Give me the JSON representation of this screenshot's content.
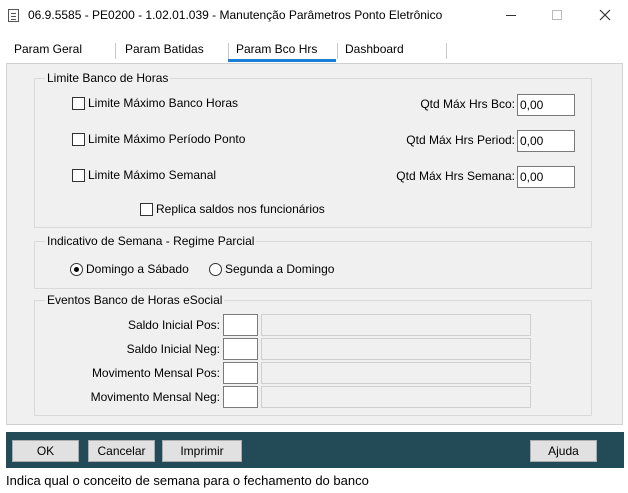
{
  "window": {
    "title": "06.9.5585 - PE0200 - 1.02.01.039 - Manutenção Parâmetros Ponto Eletrônico",
    "icon": "app-window-icon"
  },
  "tabs": [
    {
      "label": "Param Geral",
      "active": false
    },
    {
      "label": "Param Batidas",
      "active": false
    },
    {
      "label": "Param Bco Hrs",
      "active": true
    },
    {
      "label": "Dashboard",
      "active": false
    }
  ],
  "limite": {
    "title": "Limite Banco de Horas",
    "chk_max_banco": "Limite Máximo Banco Horas",
    "chk_max_periodo": "Limite Máximo Período Ponto",
    "chk_max_semanal": "Limite Máximo Semanal",
    "chk_replica": "Replica saldos nos funcionários",
    "lbl_qtd_bco": "Qtd Máx Hrs Bco:",
    "lbl_qtd_period": "Qtd Máx Hrs Period:",
    "lbl_qtd_semana": "Qtd Máx Hrs Semana:",
    "val_qtd_bco": "0,00",
    "val_qtd_period": "0,00",
    "val_qtd_semana": "0,00"
  },
  "semana": {
    "title": "Indicativo de Semana - Regime Parcial",
    "opt_domingo": "Domingo a Sábado",
    "opt_segunda": "Segunda a Domingo",
    "selected": "Domingo a Sábado"
  },
  "eventos": {
    "title": "Eventos Banco de Horas eSocial",
    "rows": [
      {
        "label": "Saldo Inicial Pos:",
        "code": "",
        "desc": ""
      },
      {
        "label": "Saldo Inicial Neg:",
        "code": "",
        "desc": ""
      },
      {
        "label": "Movimento Mensal Pos:",
        "code": "",
        "desc": ""
      },
      {
        "label": "Movimento Mensal Neg:",
        "code": "",
        "desc": ""
      }
    ]
  },
  "buttons": {
    "ok": "OK",
    "cancel": "Cancelar",
    "print": "Imprimir",
    "help": "Ajuda"
  },
  "status": "Indica qual o conceito de semana para o fechamento do banco",
  "colors": {
    "button_bar": "#234a57",
    "active_tab_line": "#1a7fd6"
  }
}
